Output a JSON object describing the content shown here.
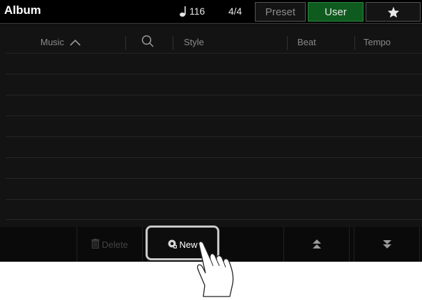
{
  "header": {
    "title": "Album",
    "tempo": "116",
    "time_signature": "4/4",
    "tabs": [
      {
        "label": "Preset",
        "active": false
      },
      {
        "label": "User",
        "active": true
      }
    ],
    "favorite_icon": "star-icon"
  },
  "columns": {
    "music": "Music",
    "sort_icon": "chevron-up-icon",
    "search_icon": "search-icon",
    "style": "Style",
    "beat": "Beat",
    "tempo": "Tempo"
  },
  "list": {
    "rows": [
      "",
      "",
      "",
      "",
      "",
      "",
      "",
      "",
      ""
    ]
  },
  "toolbar": {
    "delete_label": "Delete",
    "delete_icon": "trash-icon",
    "new_label": "New",
    "new_icon": "gear-plus-icon",
    "up_icon": "page-up-icon",
    "down_icon": "page-down-icon"
  },
  "colors": {
    "accent_active_tab": "#0f5a1e",
    "screen_bg": "#131313"
  }
}
